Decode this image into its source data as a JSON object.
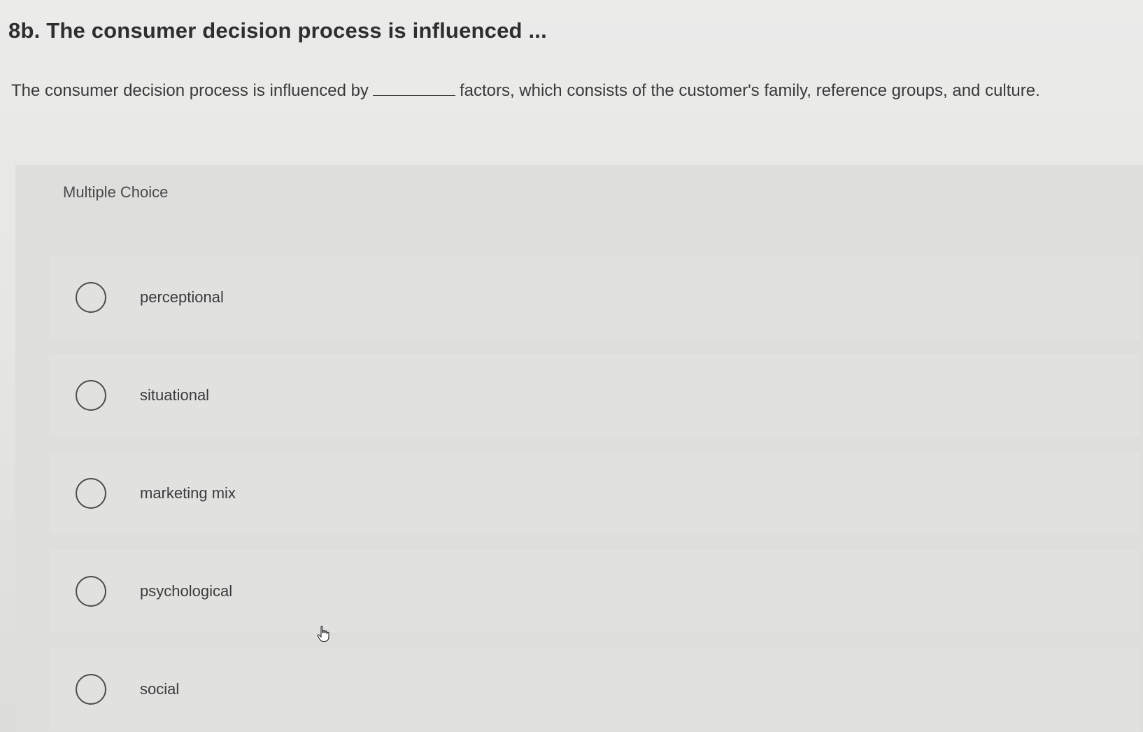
{
  "question": {
    "title": "8b. The consumer decision process is influenced ...",
    "prompt_before": "The consumer decision process is influenced by",
    "prompt_after": "factors, which consists of the customer's family, reference groups, and culture."
  },
  "choice_panel": {
    "label": "Multiple Choice",
    "options": [
      {
        "label": "perceptional"
      },
      {
        "label": "situational"
      },
      {
        "label": "marketing mix"
      },
      {
        "label": "psychological"
      },
      {
        "label": "social"
      }
    ]
  },
  "icons": {
    "cursor": "hand-pointer-icon",
    "radio": "radio-button-unselected"
  }
}
